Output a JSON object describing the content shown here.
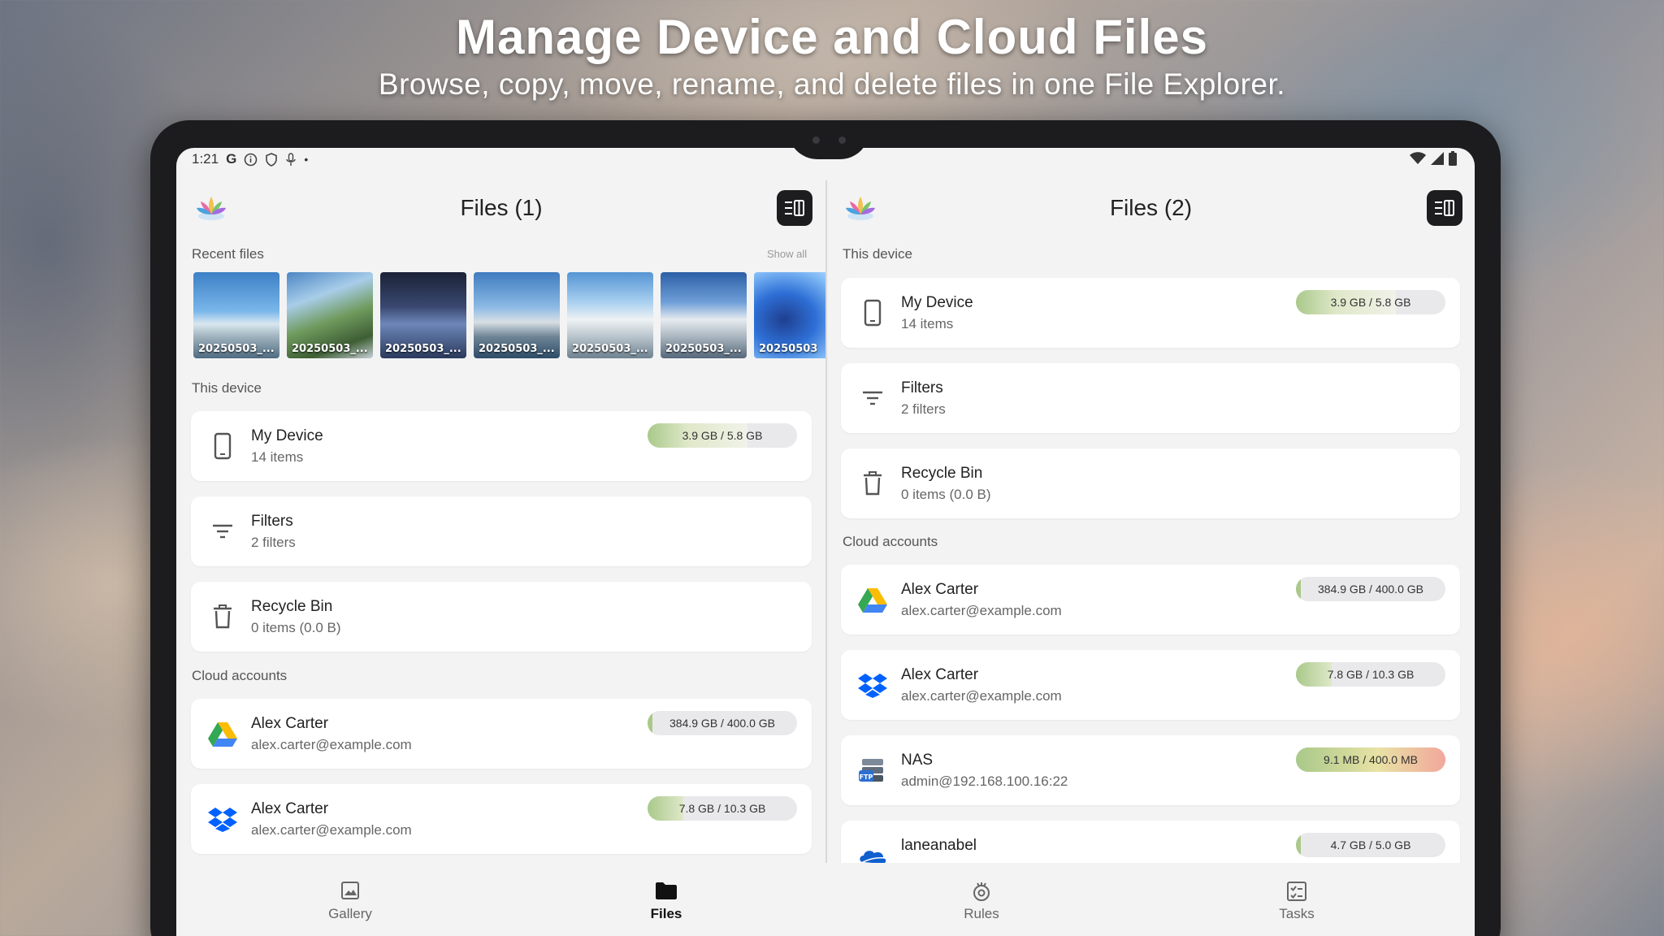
{
  "headline": {
    "title": "Manage Device and Cloud Files",
    "subtitle": "Browse, copy, move, rename, and delete files in one File Explorer."
  },
  "status_bar": {
    "time": "1:21",
    "icons": [
      "google-icon",
      "info-icon",
      "shield-icon",
      "mic-icon",
      "dot-icon",
      "wifi-icon",
      "signal-icon",
      "battery-icon"
    ]
  },
  "left_pane": {
    "title": "Files (1)",
    "recent_label": "Recent files",
    "show_all": "Show all",
    "recent_files": [
      "20250503_...",
      "20250503_...",
      "20250503_...",
      "20250503_...",
      "20250503_...",
      "20250503_...",
      "20250503"
    ],
    "this_device_label": "This device",
    "cloud_label": "Cloud accounts",
    "device_items": [
      {
        "name": "My Device",
        "sub": "14 items",
        "usage": "3.9 GB / 5.8 GB",
        "fraction": 0.67,
        "icon": "phone-icon"
      },
      {
        "name": "Filters",
        "sub": "2 filters",
        "icon": "filter-icon"
      },
      {
        "name": "Recycle Bin",
        "sub": "0 items (0.0 B)",
        "icon": "trash-icon"
      }
    ],
    "cloud_items": [
      {
        "name": "Alex Carter",
        "sub": "alex.carter@example.com",
        "usage": "384.9 GB / 400.0 GB",
        "fraction": 0.962,
        "icon": "google-drive-icon"
      },
      {
        "name": "Alex Carter",
        "sub": "alex.carter@example.com",
        "usage": "7.8 GB / 10.3 GB",
        "fraction": 0.757,
        "icon": "dropbox-icon"
      }
    ]
  },
  "right_pane": {
    "title": "Files (2)",
    "this_device_label": "This device",
    "cloud_label": "Cloud accounts",
    "device_items": [
      {
        "name": "My Device",
        "sub": "14 items",
        "usage": "3.9 GB / 5.8 GB",
        "fraction": 0.67,
        "icon": "phone-icon"
      },
      {
        "name": "Filters",
        "sub": "2 filters",
        "icon": "filter-icon"
      },
      {
        "name": "Recycle Bin",
        "sub": "0 items (0.0 B)",
        "icon": "trash-icon"
      }
    ],
    "cloud_items": [
      {
        "name": "Alex Carter",
        "sub": "alex.carter@example.com",
        "usage": "384.9 GB / 400.0 GB",
        "fraction": 0.962,
        "icon": "google-drive-icon"
      },
      {
        "name": "Alex Carter",
        "sub": "alex.carter@example.com",
        "usage": "7.8 GB / 10.3 GB",
        "fraction": 0.757,
        "icon": "dropbox-icon"
      },
      {
        "name": "NAS",
        "sub": "admin@192.168.100.16:22",
        "usage": "9.1 MB / 400.0 MB",
        "fraction": 1.0,
        "icon": "ftp-server-icon"
      },
      {
        "name": "laneanabel",
        "sub": "",
        "usage": "4.7 GB / 5.0 GB",
        "fraction": 0.94,
        "icon": "onedrive-icon"
      }
    ]
  },
  "bottom_nav": [
    {
      "label": "Gallery",
      "icon": "gallery-icon",
      "active": false
    },
    {
      "label": "Files",
      "icon": "folder-icon",
      "active": true
    },
    {
      "label": "Rules",
      "icon": "rules-icon",
      "active": false
    },
    {
      "label": "Tasks",
      "icon": "tasks-icon",
      "active": false
    }
  ],
  "colors": {
    "usage_gradient_start": "#dfe8c9",
    "usage_gradient_mid": "#a9c98a",
    "usage_warning": "#f2a79b",
    "active_nav": "#111111"
  }
}
